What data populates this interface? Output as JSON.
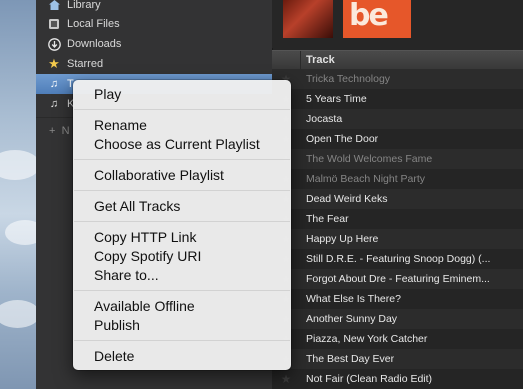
{
  "sidebar": {
    "items": [
      {
        "label": "Library",
        "icon": "library-icon"
      },
      {
        "label": "Local Files",
        "icon": "local-files-icon"
      },
      {
        "label": "Downloads",
        "icon": "downloads-icon"
      },
      {
        "label": "Starred",
        "icon": "star-icon"
      },
      {
        "label": "T",
        "icon": "playlist-icon"
      },
      {
        "label": "K",
        "icon": "playlist-icon"
      }
    ],
    "new_playlist_label": "N"
  },
  "tracklist": {
    "column_header": "Track",
    "rows": [
      {
        "name": "Tricka Technology",
        "dim": true
      },
      {
        "name": "5 Years Time",
        "dim": false
      },
      {
        "name": "Jocasta",
        "dim": false
      },
      {
        "name": "Open The Door",
        "dim": false
      },
      {
        "name": "The Wold Welcomes Fame",
        "dim": true
      },
      {
        "name": "Malmö Beach Night Party",
        "dim": true
      },
      {
        "name": "Dead Weird Keks",
        "dim": false
      },
      {
        "name": "The Fear",
        "dim": false
      },
      {
        "name": "Happy Up Here",
        "dim": false
      },
      {
        "name": "Still D.R.E. - Featuring Snoop Dogg) (...",
        "dim": false
      },
      {
        "name": "Forgot About Dre - Featuring Eminem...",
        "dim": false
      },
      {
        "name": "What Else Is There?",
        "dim": false
      },
      {
        "name": "Another Sunny Day",
        "dim": false
      },
      {
        "name": "Piazza, New York Catcher",
        "dim": false
      },
      {
        "name": "The Best Day Ever",
        "dim": false
      },
      {
        "name": "Not Fair (Clean Radio Edit)",
        "dim": false
      }
    ]
  },
  "album_art": {
    "second_text": "be"
  },
  "context_menu": {
    "play": "Play",
    "rename": "Rename",
    "choose_current": "Choose as Current Playlist",
    "collaborative": "Collaborative Playlist",
    "get_all_tracks": "Get All Tracks",
    "copy_http_link": "Copy HTTP Link",
    "copy_spotify_uri": "Copy Spotify URI",
    "share_to": "Share to...",
    "available_offline": "Available Offline",
    "publish": "Publish",
    "delete": "Delete"
  },
  "colors": {
    "selection": "#5c89c4",
    "sidebar_bg": "#333334",
    "list_bg": "#262626",
    "menu_bg": "#f0f0f0"
  }
}
